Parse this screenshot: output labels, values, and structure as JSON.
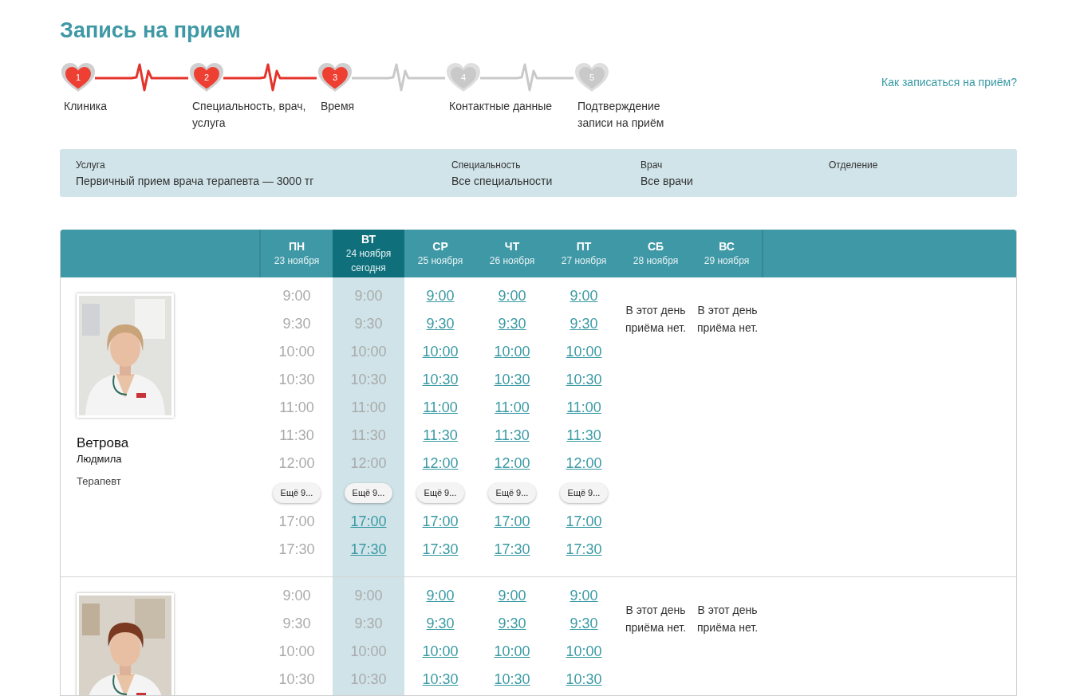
{
  "title": "Запись на прием",
  "steps": [
    {
      "number": "1",
      "label": "Клиника",
      "completed": true
    },
    {
      "number": "2",
      "label": "Специальность, врач, услуга",
      "completed": true
    },
    {
      "number": "3",
      "label": "Время",
      "completed": true
    },
    {
      "number": "4",
      "label": "Контактные данные",
      "completed": false
    },
    {
      "number": "5",
      "label": "Подтверждение записи на приём",
      "completed": false
    }
  ],
  "help_link": "Как записаться на приём?",
  "filters": [
    {
      "label": "Услуга",
      "value": "Первичный прием врача терапевта — 3000 тг"
    },
    {
      "label": "Специальность",
      "value": "Все специальности"
    },
    {
      "label": "Врач",
      "value": "Все врачи"
    },
    {
      "label": "Отделение"
    }
  ],
  "days": [
    {
      "weekday": "ПН",
      "date": "23 ноября",
      "today": false
    },
    {
      "weekday": "ВТ",
      "date": "24 ноября",
      "today": true,
      "today_label": "сегодня"
    },
    {
      "weekday": "СР",
      "date": "25 ноября",
      "today": false
    },
    {
      "weekday": "ЧТ",
      "date": "26 ноября",
      "today": false
    },
    {
      "weekday": "ПТ",
      "date": "27 ноября",
      "today": false
    },
    {
      "weekday": "СБ",
      "date": "28 ноября",
      "today": false
    },
    {
      "weekday": "ВС",
      "date": "29 ноября",
      "today": false
    }
  ],
  "doctors": [
    {
      "surname": "Ветрова",
      "first_name": "Людмила",
      "role": "Терапевт",
      "schedule": [
        {
          "kind": "slots",
          "items": [
            {
              "kind": "time",
              "time": "9:00",
              "available": false
            },
            {
              "kind": "time",
              "time": "9:30",
              "available": false
            },
            {
              "kind": "time",
              "time": "10:00",
              "available": false
            },
            {
              "kind": "time",
              "time": "10:30",
              "available": false
            },
            {
              "kind": "time",
              "time": "11:00",
              "available": false
            },
            {
              "kind": "time",
              "time": "11:30",
              "available": false
            },
            {
              "kind": "time",
              "time": "12:00",
              "available": false
            },
            {
              "kind": "more",
              "label": "Ещё 9..."
            },
            {
              "kind": "time",
              "time": "17:00",
              "available": false
            },
            {
              "kind": "time",
              "time": "17:30",
              "available": false
            }
          ]
        },
        {
          "kind": "slots",
          "items": [
            {
              "kind": "time",
              "time": "9:00",
              "available": false
            },
            {
              "kind": "time",
              "time": "9:30",
              "available": false
            },
            {
              "kind": "time",
              "time": "10:00",
              "available": false
            },
            {
              "kind": "time",
              "time": "10:30",
              "available": false
            },
            {
              "kind": "time",
              "time": "11:00",
              "available": false
            },
            {
              "kind": "time",
              "time": "11:30",
              "available": false
            },
            {
              "kind": "time",
              "time": "12:00",
              "available": false
            },
            {
              "kind": "more",
              "label": "Ещё 9..."
            },
            {
              "kind": "time",
              "time": "17:00",
              "available": true
            },
            {
              "kind": "time",
              "time": "17:30",
              "available": true
            }
          ]
        },
        {
          "kind": "slots",
          "items": [
            {
              "kind": "time",
              "time": "9:00",
              "available": true
            },
            {
              "kind": "time",
              "time": "9:30",
              "available": true
            },
            {
              "kind": "time",
              "time": "10:00",
              "available": true
            },
            {
              "kind": "time",
              "time": "10:30",
              "available": true
            },
            {
              "kind": "time",
              "time": "11:00",
              "available": true
            },
            {
              "kind": "time",
              "time": "11:30",
              "available": true
            },
            {
              "kind": "time",
              "time": "12:00",
              "available": true
            },
            {
              "kind": "more",
              "label": "Ещё 9..."
            },
            {
              "kind": "time",
              "time": "17:00",
              "available": true
            },
            {
              "kind": "time",
              "time": "17:30",
              "available": true
            }
          ]
        },
        {
          "kind": "slots",
          "items": [
            {
              "kind": "time",
              "time": "9:00",
              "available": true
            },
            {
              "kind": "time",
              "time": "9:30",
              "available": true
            },
            {
              "kind": "time",
              "time": "10:00",
              "available": true
            },
            {
              "kind": "time",
              "time": "10:30",
              "available": true
            },
            {
              "kind": "time",
              "time": "11:00",
              "available": true
            },
            {
              "kind": "time",
              "time": "11:30",
              "available": true
            },
            {
              "kind": "time",
              "time": "12:00",
              "available": true
            },
            {
              "kind": "more",
              "label": "Ещё 9..."
            },
            {
              "kind": "time",
              "time": "17:00",
              "available": true
            },
            {
              "kind": "time",
              "time": "17:30",
              "available": true
            }
          ]
        },
        {
          "kind": "slots",
          "items": [
            {
              "kind": "time",
              "time": "9:00",
              "available": true
            },
            {
              "kind": "time",
              "time": "9:30",
              "available": true
            },
            {
              "kind": "time",
              "time": "10:00",
              "available": true
            },
            {
              "kind": "time",
              "time": "10:30",
              "available": true
            },
            {
              "kind": "time",
              "time": "11:00",
              "available": true
            },
            {
              "kind": "time",
              "time": "11:30",
              "available": true
            },
            {
              "kind": "time",
              "time": "12:00",
              "available": true
            },
            {
              "kind": "more",
              "label": "Ещё 9..."
            },
            {
              "kind": "time",
              "time": "17:00",
              "available": true
            },
            {
              "kind": "time",
              "time": "17:30",
              "available": true
            }
          ]
        },
        {
          "kind": "closed",
          "note": "В этот день приёма нет."
        },
        {
          "kind": "closed",
          "note": "В этот день приёма нет."
        }
      ]
    },
    {
      "schedule": [
        {
          "kind": "slots",
          "items": [
            {
              "kind": "time",
              "time": "9:00",
              "available": false
            },
            {
              "kind": "time",
              "time": "9:30",
              "available": false
            },
            {
              "kind": "time",
              "time": "10:00",
              "available": false
            },
            {
              "kind": "time",
              "time": "10:30",
              "available": false
            }
          ]
        },
        {
          "kind": "slots",
          "items": [
            {
              "kind": "time",
              "time": "9:00",
              "available": false
            },
            {
              "kind": "time",
              "time": "9:30",
              "available": false
            },
            {
              "kind": "time",
              "time": "10:00",
              "available": false
            },
            {
              "kind": "time",
              "time": "10:30",
              "available": false
            }
          ]
        },
        {
          "kind": "slots",
          "items": [
            {
              "kind": "time",
              "time": "9:00",
              "available": true
            },
            {
              "kind": "time",
              "time": "9:30",
              "available": true
            },
            {
              "kind": "time",
              "time": "10:00",
              "available": true
            },
            {
              "kind": "time",
              "time": "10:30",
              "available": true
            }
          ]
        },
        {
          "kind": "slots",
          "items": [
            {
              "kind": "time",
              "time": "9:00",
              "available": true
            },
            {
              "kind": "time",
              "time": "9:30",
              "available": true
            },
            {
              "kind": "time",
              "time": "10:00",
              "available": true
            },
            {
              "kind": "time",
              "time": "10:30",
              "available": true
            }
          ]
        },
        {
          "kind": "slots",
          "items": [
            {
              "kind": "time",
              "time": "9:00",
              "available": true
            },
            {
              "kind": "time",
              "time": "9:30",
              "available": true
            },
            {
              "kind": "time",
              "time": "10:00",
              "available": true
            },
            {
              "kind": "time",
              "time": "10:30",
              "available": true
            }
          ]
        },
        {
          "kind": "closed",
          "note": "В этот день приёма нет."
        },
        {
          "kind": "closed",
          "note": "В этот день приёма нет."
        }
      ]
    }
  ]
}
